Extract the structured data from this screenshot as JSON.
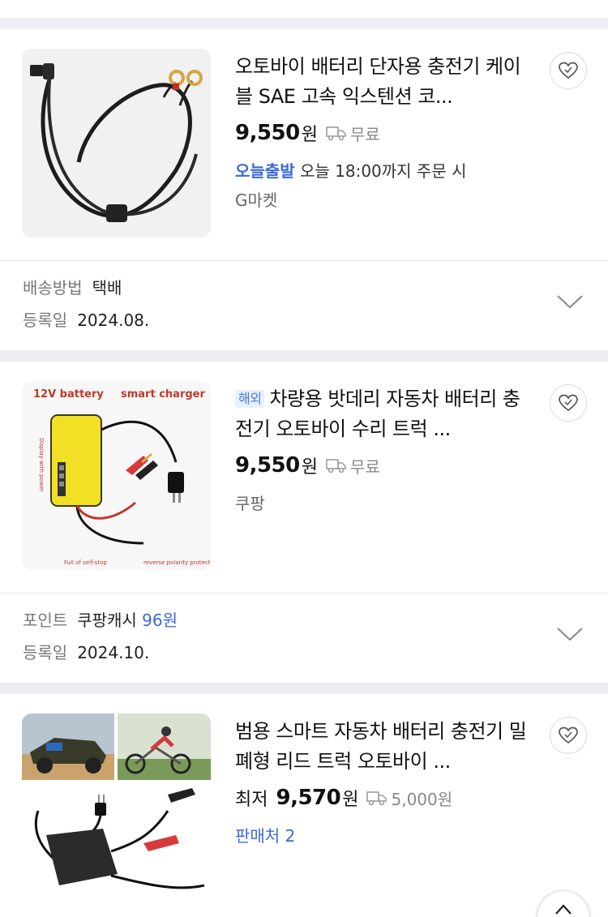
{
  "products": [
    {
      "title": "오토바이 배터리 단자용 충전기 케이블 SAE 고속 익스텐션 코...",
      "badge": "",
      "price_prefix": "",
      "price_number": "9,550",
      "price_unit": "원",
      "shipping": "무료",
      "line1_highlight": "오늘출발",
      "line1_text": "오늘 18:00까지 주문 시",
      "line2_text": "G마켓",
      "image": "sae-cable-image"
    },
    {
      "title": "차량용 밧데리 자동차 배터리 충전기 오토바이 수리 트럭 ...",
      "badge": "해외",
      "price_prefix": "",
      "price_number": "9,550",
      "price_unit": "원",
      "shipping": "무료",
      "line1_text": "쿠팡",
      "image_text": {
        "top_left": "12V battery",
        "top_right": "smart charger",
        "side": "Display with power",
        "bottom_left": "Full of self-stop",
        "bottom_right": "reverse polarity protection"
      }
    },
    {
      "title": "범용 스마트 자동차 배터리 충전기 밀폐형 리드 트럭 오토바이 ...",
      "badge": "",
      "price_prefix": "최저",
      "price_number": "9,570",
      "price_unit": "원",
      "shipping": "5,000원",
      "line1_text": "판매처 2",
      "image": "charger-collage-image"
    }
  ],
  "meta": [
    {
      "row1_key": "배송방법",
      "row1_value": "택배",
      "row2_key": "등록일",
      "row2_value": "2024.08."
    },
    {
      "row1_key": "포인트",
      "row1_value": "쿠팡캐시",
      "row1_extra": "96원",
      "row2_key": "등록일",
      "row2_value": "2024.10."
    }
  ],
  "colors": {
    "accent_blue": "#3b6bd6",
    "separator": "#eeeef2",
    "badge_bg": "#e7f0fb"
  },
  "icons": [
    "heart-icon",
    "truck-icon",
    "chevron-down-icon",
    "arrow-up-icon"
  ]
}
